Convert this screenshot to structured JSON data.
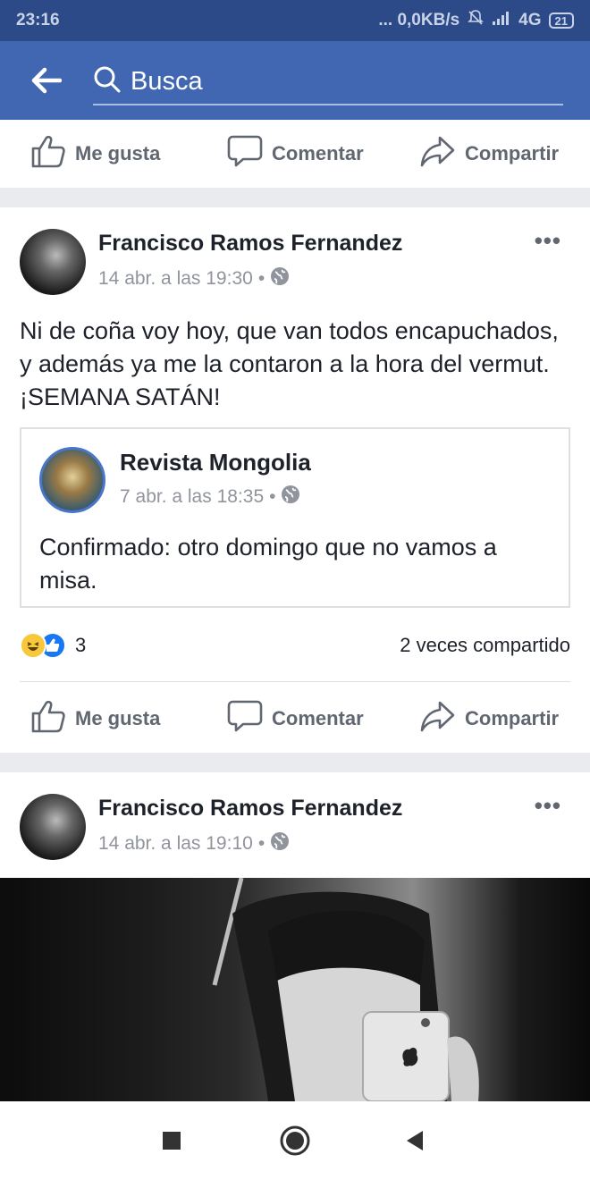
{
  "status_bar": {
    "time": "23:16",
    "indicators": "... 0,0KB/s",
    "network": "4G",
    "battery": "21"
  },
  "search": {
    "placeholder": "Busca"
  },
  "action_labels": {
    "like": "Me gusta",
    "comment": "Comentar",
    "share": "Compartir"
  },
  "posts": [
    {
      "author": "Francisco Ramos Fernandez",
      "date": "14 abr. a las 19:30",
      "privacy_icon": "globe-icon",
      "text": "Ni de coña voy hoy, que van todos encapuchados, y además ya me la  contaron a la hora del vermut. ¡SEMANA SATÁN!",
      "shared": {
        "author": "Revista Mongolia",
        "date": "7 abr. a las 18:35",
        "privacy_icon": "globe-icon",
        "text": "Confirmado: otro domingo que no vamos a misa."
      },
      "reactions": {
        "types": [
          "haha",
          "like"
        ],
        "count": "3"
      },
      "shares": "2 veces compartido"
    },
    {
      "author": "Francisco Ramos Fernandez",
      "date": "14 abr. a las 19:10",
      "privacy_icon": "globe-icon"
    }
  ],
  "colors": {
    "brand": "#4267b2",
    "status": "#2d4a88",
    "separator": "#e9ebee"
  }
}
